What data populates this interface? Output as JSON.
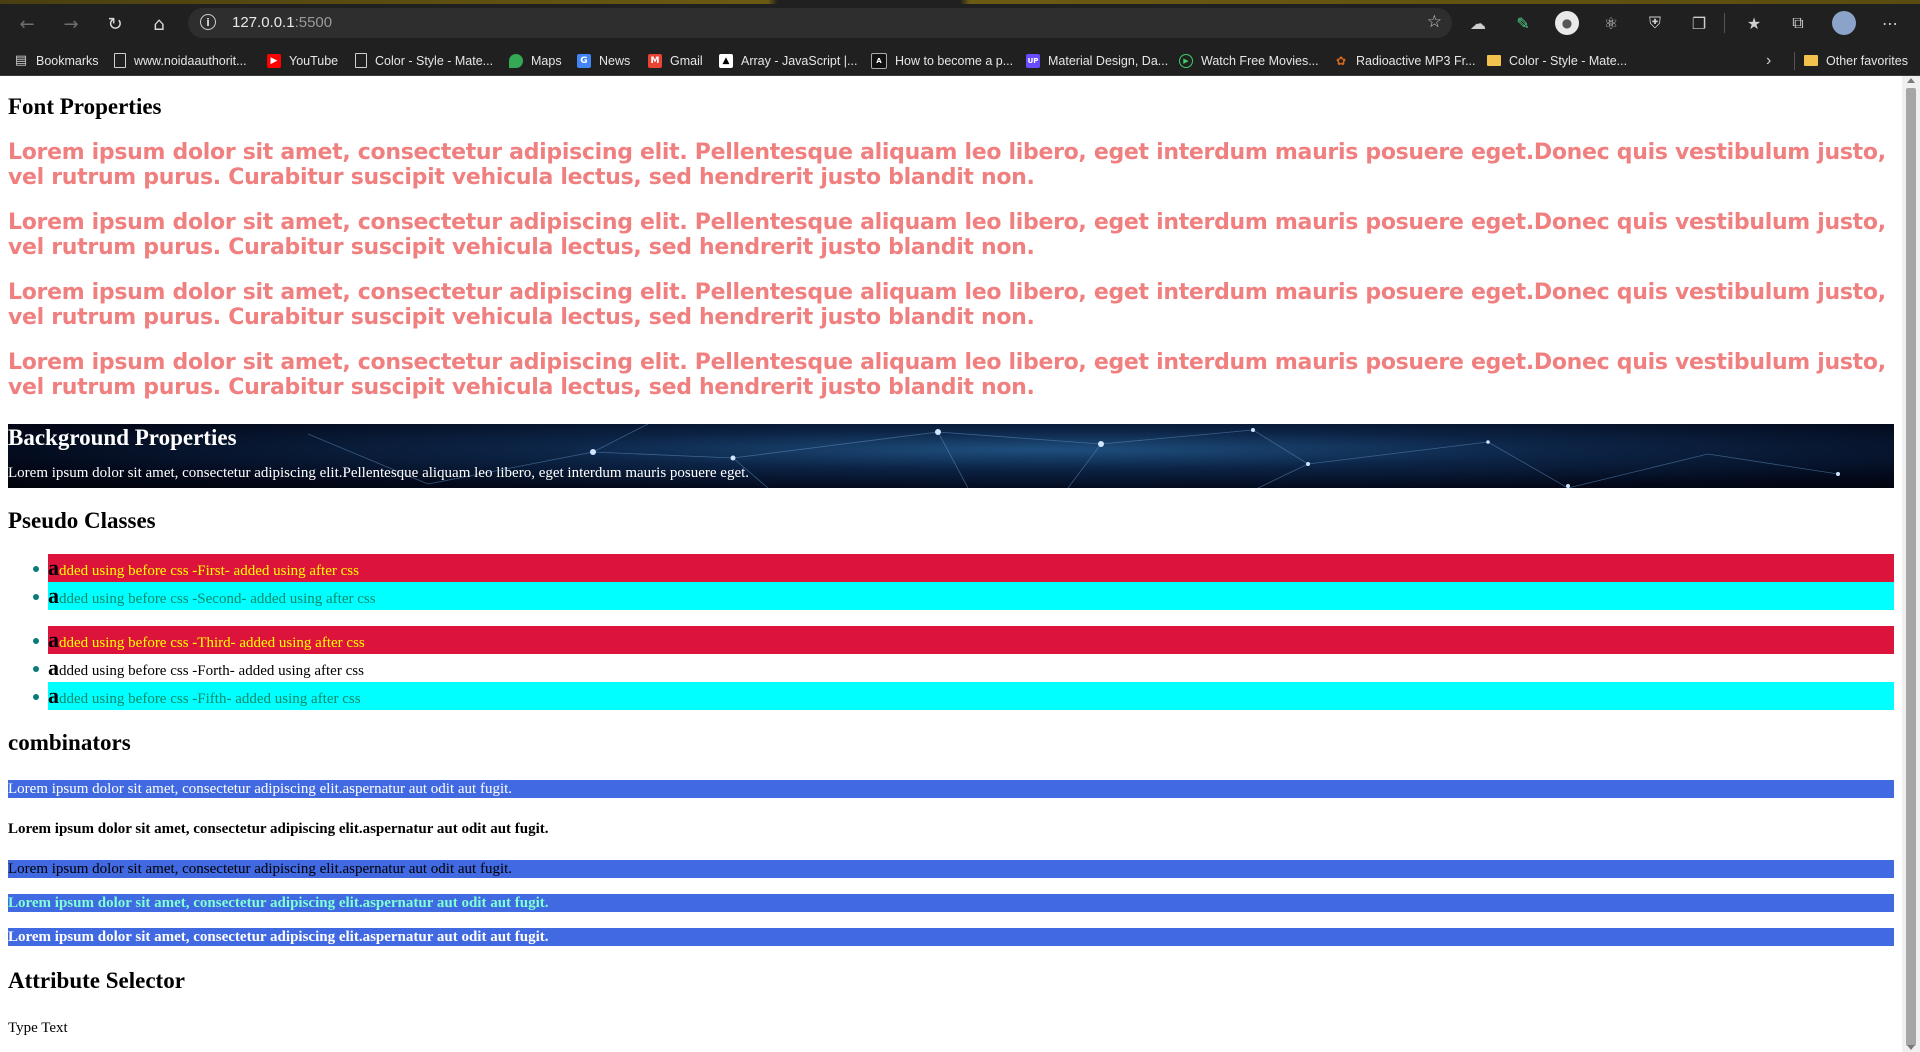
{
  "browser": {
    "url_host": "127.0.0.1",
    "url_port": ":5500",
    "bookmarks": [
      {
        "label": "Bookmarks",
        "icon": "bookmarks-icon"
      },
      {
        "label": "www.noidaauthorit...",
        "icon": "page-icon"
      },
      {
        "label": "YouTube",
        "icon": "youtube-icon"
      },
      {
        "label": "Color - Style - Mate...",
        "icon": "page-icon"
      },
      {
        "label": "Maps",
        "icon": "maps-icon"
      },
      {
        "label": "News",
        "icon": "news-icon"
      },
      {
        "label": "Gmail",
        "icon": "gmail-icon"
      },
      {
        "label": "Array - JavaScript |...",
        "icon": "mdn-icon"
      },
      {
        "label": "How to become a p...",
        "icon": "site-icon"
      },
      {
        "label": "Material Design, Da...",
        "icon": "up-icon"
      },
      {
        "label": "Watch Free Movies...",
        "icon": "play-icon"
      },
      {
        "label": "Radioactive MP3 Fr...",
        "icon": "paw-icon"
      },
      {
        "label": "Color - Style - Mate...",
        "icon": "folder-icon"
      }
    ],
    "other_favorites": "Other favorites",
    "colors": {
      "chrome_bg": "#202020",
      "address_bg": "#2e2e2e"
    }
  },
  "page": {
    "font_section": {
      "title": "Font Properties",
      "paragraphs": [
        "Lorem ipsum dolor sit amet, consectetur adipiscing elit. Pellentesque aliquam leo libero, eget interdum mauris posuere eget.Donec quis vestibulum justo, vel rutrum purus. Curabitur suscipit vehicula lectus, sed hendrerit justo blandit non.",
        "Lorem ipsum dolor sit amet, consectetur adipiscing elit. Pellentesque aliquam leo libero, eget interdum mauris posuere eget.Donec quis vestibulum justo, vel rutrum purus. Curabitur suscipit vehicula lectus, sed hendrerit justo blandit non.",
        "Lorem ipsum dolor sit amet, consectetur adipiscing elit. Pellentesque aliquam leo libero, eget interdum mauris posuere eget.Donec quis vestibulum justo, vel rutrum purus. Curabitur suscipit vehicula lectus, sed hendrerit justo blandit non.",
        "Lorem ipsum dolor sit amet, consectetur adipiscing elit. Pellentesque aliquam leo libero, eget interdum mauris posuere eget.Donec quis vestibulum justo, vel rutrum purus. Curabitur suscipit vehicula lectus, sed hendrerit justo blandit non."
      ],
      "color": "#f08080"
    },
    "background_section": {
      "title": "Background Properties",
      "text": "Lorem ipsum dolor sit amet, consectetur adipiscing elit.Pellentesque aliquam leo libero, eget interdum mauris posuere eget."
    },
    "pseudo_section": {
      "title": "Pseudo Classes",
      "items": [
        {
          "cap": "a",
          "text": "dded using before css -First- added using after css",
          "style": "red"
        },
        {
          "cap": "a",
          "text": "dded using before css -Second- added using after css",
          "style": "cyan"
        },
        {
          "cap": "a",
          "text": "dded using before css -Third- added using after css",
          "style": "red"
        },
        {
          "cap": "a",
          "text": "dded using before css -Forth- added using after css",
          "style": "plain"
        },
        {
          "cap": "a",
          "text": "dded using before css -Fifth- added using after css",
          "style": "cyan"
        }
      ],
      "colors": {
        "red": "#dc143c",
        "cyan": "#00ffff",
        "yellow": "#ffff00"
      }
    },
    "combinators_section": {
      "title": "combinators",
      "lines": [
        "Lorem ipsum dolor sit amet, consectetur adipiscing elit.aspernatur aut odit aut fugit.",
        "Lorem ipsum dolor sit amet, consectetur adipiscing elit.aspernatur aut odit aut fugit.",
        "Lorem ipsum dolor sit amet, consectetur adipiscing elit.aspernatur aut odit aut fugit.",
        "Lorem ipsum dolor sit amet, consectetur adipiscing elit.aspernatur aut odit aut fugit.",
        "Lorem ipsum dolor sit amet, consectetur adipiscing elit.aspernatur aut odit aut fugit."
      ],
      "color": "#4169e1"
    },
    "attribute_section": {
      "title": "Attribute Selector",
      "type_text": "Type Text"
    }
  }
}
